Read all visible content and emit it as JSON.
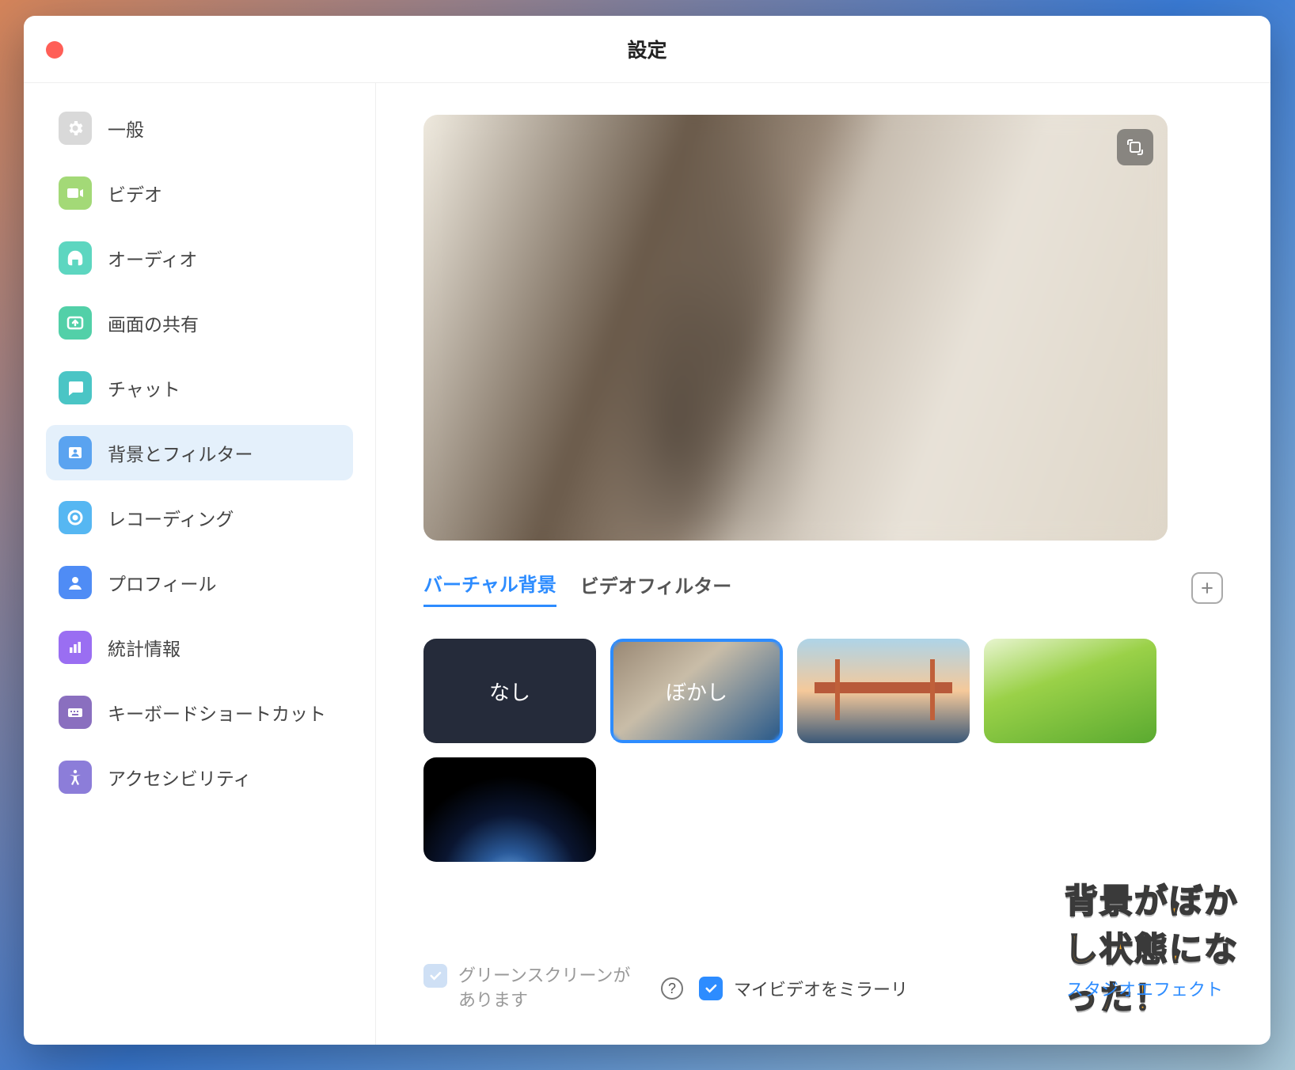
{
  "window": {
    "title": "設定"
  },
  "sidebar": {
    "items": [
      {
        "label": "一般",
        "icon": "gear-icon",
        "color": "#d9d9d9"
      },
      {
        "label": "ビデオ",
        "icon": "video-icon",
        "color": "#a3d977"
      },
      {
        "label": "オーディオ",
        "icon": "headphones-icon",
        "color": "#5dd6c0"
      },
      {
        "label": "画面の共有",
        "icon": "share-screen-icon",
        "color": "#52d0a8"
      },
      {
        "label": "チャット",
        "icon": "chat-icon",
        "color": "#4ac5c5"
      },
      {
        "label": "背景とフィルター",
        "icon": "background-icon",
        "color": "#5aa3f0",
        "active": true
      },
      {
        "label": "レコーディング",
        "icon": "record-icon",
        "color": "#56b7f2"
      },
      {
        "label": "プロフィール",
        "icon": "profile-icon",
        "color": "#4f8cf5"
      },
      {
        "label": "統計情報",
        "icon": "stats-icon",
        "color": "#9a6ef2"
      },
      {
        "label": "キーボードショートカット",
        "icon": "keyboard-icon",
        "color": "#8a6fbf"
      },
      {
        "label": "アクセシビリティ",
        "icon": "accessibility-icon",
        "color": "#8c7dd9"
      }
    ]
  },
  "tabs": {
    "virtual_bg": "バーチャル背景",
    "video_filter": "ビデオフィルター"
  },
  "bg_options": {
    "none": "なし",
    "blur": "ぼかし"
  },
  "bottom": {
    "greenscreen": "グリーンスクリーンがあります",
    "mirror": "マイビデオをミラーリ",
    "studio": "スタジオエフェクト"
  },
  "annotation": "背景がぼかし状態になった！"
}
